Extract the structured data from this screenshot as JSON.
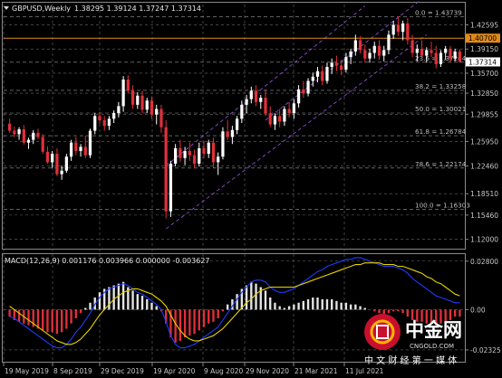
{
  "header": {
    "title": "GBPUSD,Weekly",
    "ohlc": "1.38295 1.39124 1.37247 1.37314",
    "macd_label": "MACD(12,26,9) 0.001176 0.003966 0.000000 -0.003627"
  },
  "watermark": {
    "brand": "中金网",
    "domain": "CNGOLD.COM",
    "tagline": "中 文 财 经 第 一 媒 体"
  },
  "chart_data": {
    "type": "candlestick",
    "symbol": "GBPUSD",
    "timeframe": "Weekly",
    "ohlc": [
      1.38295,
      1.39124,
      1.37247,
      1.37314
    ],
    "price_ticks": [
      "1.42595",
      "1.39150",
      "1.35700",
      "1.32850",
      "1.29855",
      "1.25950",
      "1.22460",
      "1.18510",
      "1.15460",
      "1.12000"
    ],
    "price_range": [
      1.108,
      1.455
    ],
    "x_ticks": [
      "19 May 2019",
      "8 Sep 2019",
      "29 Dec 2019",
      "19 Apr 2020",
      "9 Aug 2020",
      "29 Nov 2020",
      "21 Mar 2021",
      "11 Jul 2021"
    ],
    "horizontal_line": {
      "price": 1.407,
      "label": "1.40700",
      "color": "#e08a1a"
    },
    "current_price": {
      "price": 1.37314,
      "label": "1.37314"
    },
    "fibonacci": [
      {
        "label": "0.0 = 1.43739",
        "price": 1.43739
      },
      {
        "label": "23.6 = 1.37264",
        "price": 1.37264
      },
      {
        "label": "38.2 = 1.33258",
        "price": 1.33258
      },
      {
        "label": "50.0 = 1.30021",
        "price": 1.30021
      },
      {
        "label": "61.8 = 1.26784",
        "price": 1.26784
      },
      {
        "label": "78.6 = 1.22174",
        "price": 1.22174
      },
      {
        "label": "100.0 = 1.16303",
        "price": 1.16303
      }
    ],
    "channel_color": "#8a4cd0",
    "colors": {
      "bull": "#ffffff",
      "bear": "#e0303a",
      "grid": "#6a6a6a",
      "macd_line": "#1e3cff",
      "signal_line": "#e6d200"
    },
    "candles": [
      [
        1.285,
        1.292,
        1.272,
        1.275
      ],
      [
        1.275,
        1.281,
        1.266,
        1.27
      ],
      [
        1.27,
        1.28,
        1.262,
        1.277
      ],
      [
        1.277,
        1.283,
        1.255,
        1.258
      ],
      [
        1.258,
        1.265,
        1.249,
        1.262
      ],
      [
        1.262,
        1.276,
        1.256,
        1.272
      ],
      [
        1.272,
        1.278,
        1.263,
        1.266
      ],
      [
        1.266,
        1.27,
        1.242,
        1.245
      ],
      [
        1.245,
        1.253,
        1.228,
        1.23
      ],
      [
        1.23,
        1.246,
        1.222,
        1.242
      ],
      [
        1.242,
        1.25,
        1.21,
        1.213
      ],
      [
        1.213,
        1.225,
        1.205,
        1.218
      ],
      [
        1.218,
        1.242,
        1.215,
        1.238
      ],
      [
        1.238,
        1.262,
        1.232,
        1.258
      ],
      [
        1.258,
        1.266,
        1.24,
        1.246
      ],
      [
        1.246,
        1.256,
        1.238,
        1.252
      ],
      [
        1.252,
        1.268,
        1.236,
        1.24
      ],
      [
        1.24,
        1.278,
        1.236,
        1.275
      ],
      [
        1.275,
        1.3,
        1.27,
        1.296
      ],
      [
        1.296,
        1.302,
        1.285,
        1.29
      ],
      [
        1.29,
        1.296,
        1.275,
        1.282
      ],
      [
        1.282,
        1.296,
        1.276,
        1.292
      ],
      [
        1.292,
        1.304,
        1.286,
        1.3
      ],
      [
        1.3,
        1.316,
        1.294,
        1.31
      ],
      [
        1.31,
        1.353,
        1.302,
        1.348
      ],
      [
        1.348,
        1.354,
        1.328,
        1.332
      ],
      [
        1.332,
        1.34,
        1.306,
        1.312
      ],
      [
        1.312,
        1.33,
        1.306,
        1.325
      ],
      [
        1.325,
        1.332,
        1.3,
        1.305
      ],
      [
        1.305,
        1.322,
        1.3,
        1.318
      ],
      [
        1.318,
        1.324,
        1.292,
        1.298
      ],
      [
        1.298,
        1.312,
        1.284,
        1.306
      ],
      [
        1.306,
        1.312,
        1.272,
        1.28
      ],
      [
        1.28,
        1.29,
        1.15,
        1.16
      ],
      [
        1.16,
        1.232,
        1.152,
        1.228
      ],
      [
        1.228,
        1.256,
        1.224,
        1.25
      ],
      [
        1.25,
        1.262,
        1.23,
        1.236
      ],
      [
        1.236,
        1.252,
        1.226,
        1.246
      ],
      [
        1.246,
        1.258,
        1.232,
        1.24
      ],
      [
        1.24,
        1.248,
        1.222,
        1.228
      ],
      [
        1.228,
        1.258,
        1.224,
        1.25
      ],
      [
        1.25,
        1.26,
        1.236,
        1.242
      ],
      [
        1.242,
        1.262,
        1.236,
        1.258
      ],
      [
        1.258,
        1.265,
        1.222,
        1.23
      ],
      [
        1.23,
        1.244,
        1.212,
        1.238
      ],
      [
        1.238,
        1.28,
        1.234,
        1.274
      ],
      [
        1.274,
        1.29,
        1.262,
        1.266
      ],
      [
        1.266,
        1.282,
        1.256,
        1.276
      ],
      [
        1.276,
        1.296,
        1.27,
        1.292
      ],
      [
        1.292,
        1.318,
        1.286,
        1.312
      ],
      [
        1.312,
        1.326,
        1.3,
        1.32
      ],
      [
        1.32,
        1.338,
        1.314,
        1.332
      ],
      [
        1.332,
        1.34,
        1.31,
        1.316
      ],
      [
        1.316,
        1.326,
        1.306,
        1.322
      ],
      [
        1.322,
        1.334,
        1.296,
        1.3
      ],
      [
        1.3,
        1.31,
        1.28,
        1.284
      ],
      [
        1.284,
        1.3,
        1.276,
        1.296
      ],
      [
        1.296,
        1.306,
        1.28,
        1.288
      ],
      [
        1.288,
        1.31,
        1.282,
        1.306
      ],
      [
        1.306,
        1.316,
        1.294,
        1.3
      ],
      [
        1.3,
        1.32,
        1.292,
        1.314
      ],
      [
        1.314,
        1.34,
        1.308,
        1.334
      ],
      [
        1.334,
        1.346,
        1.322,
        1.328
      ],
      [
        1.328,
        1.35,
        1.324,
        1.346
      ],
      [
        1.346,
        1.358,
        1.338,
        1.352
      ],
      [
        1.352,
        1.366,
        1.344,
        1.36
      ],
      [
        1.36,
        1.368,
        1.34,
        1.346
      ],
      [
        1.346,
        1.372,
        1.342,
        1.366
      ],
      [
        1.366,
        1.378,
        1.356,
        1.372
      ],
      [
        1.372,
        1.382,
        1.36,
        1.368
      ],
      [
        1.368,
        1.376,
        1.354,
        1.362
      ],
      [
        1.362,
        1.386,
        1.358,
        1.38
      ],
      [
        1.38,
        1.392,
        1.37,
        1.388
      ],
      [
        1.388,
        1.412,
        1.382,
        1.404
      ],
      [
        1.404,
        1.41,
        1.385,
        1.39
      ],
      [
        1.39,
        1.398,
        1.372,
        1.378
      ],
      [
        1.378,
        1.392,
        1.372,
        1.386
      ],
      [
        1.386,
        1.402,
        1.378,
        1.396
      ],
      [
        1.396,
        1.404,
        1.376,
        1.382
      ],
      [
        1.382,
        1.396,
        1.374,
        1.39
      ],
      [
        1.39,
        1.418,
        1.384,
        1.412
      ],
      [
        1.412,
        1.432,
        1.406,
        1.426
      ],
      [
        1.426,
        1.438,
        1.41,
        1.416
      ],
      [
        1.416,
        1.432,
        1.404,
        1.428
      ],
      [
        1.428,
        1.436,
        1.398,
        1.404
      ],
      [
        1.404,
        1.412,
        1.38,
        1.386
      ],
      [
        1.386,
        1.398,
        1.374,
        1.392
      ],
      [
        1.392,
        1.404,
        1.378,
        1.382
      ],
      [
        1.382,
        1.394,
        1.372,
        1.39
      ],
      [
        1.39,
        1.402,
        1.38,
        1.386
      ],
      [
        1.386,
        1.396,
        1.364,
        1.37
      ],
      [
        1.37,
        1.39,
        1.366,
        1.386
      ],
      [
        1.386,
        1.396,
        1.376,
        1.392
      ],
      [
        1.392,
        1.396,
        1.372,
        1.378
      ],
      [
        1.378,
        1.392,
        1.374,
        1.388
      ],
      [
        1.388,
        1.3912,
        1.3725,
        1.3731
      ]
    ],
    "macd": {
      "name": "MACD(12,26,9)",
      "values": [
        0.001176,
        0.003966,
        0.0,
        -0.003627
      ],
      "ticks": [
        "0.02800",
        "0.00",
        "-0.02325"
      ],
      "range": [
        -0.029,
        0.031
      ],
      "histogram": [
        -0.004,
        -0.006,
        -0.007,
        -0.008,
        -0.009,
        -0.01,
        -0.011,
        -0.012,
        -0.013,
        -0.013,
        -0.014,
        -0.013,
        -0.011,
        -0.008,
        -0.005,
        -0.002,
        0.001,
        0.004,
        0.007,
        0.01,
        0.012,
        0.013,
        0.014,
        0.015,
        0.016,
        0.013,
        0.011,
        0.009,
        0.008,
        0.006,
        0.004,
        0.002,
        -0.001,
        -0.008,
        -0.016,
        -0.019,
        -0.018,
        -0.016,
        -0.015,
        -0.014,
        -0.012,
        -0.01,
        -0.008,
        -0.007,
        -0.005,
        -0.001,
        0.003,
        0.006,
        0.009,
        0.012,
        0.014,
        0.016,
        0.015,
        0.013,
        0.011,
        0.007,
        0.004,
        0.002,
        0.001,
        0.002,
        0.003,
        0.004,
        0.005,
        0.006,
        0.007,
        0.007,
        0.006,
        0.006,
        0.006,
        0.005,
        0.004,
        0.004,
        0.003,
        0.003,
        0.002,
        0.001,
        0.0,
        -0.001,
        -0.002,
        -0.003,
        -0.002,
        -0.001,
        -0.001,
        -0.002,
        -0.004,
        -0.006,
        -0.007,
        -0.007,
        -0.008,
        -0.008,
        -0.009,
        -0.008,
        -0.007,
        -0.006,
        -0.004,
        -0.004
      ],
      "macd_line": [
        -0.004,
        -0.005,
        -0.007,
        -0.009,
        -0.011,
        -0.013,
        -0.015,
        -0.017,
        -0.019,
        -0.021,
        -0.022,
        -0.022,
        -0.02,
        -0.017,
        -0.013,
        -0.01,
        -0.006,
        -0.002,
        0.003,
        0.007,
        0.01,
        0.012,
        0.013,
        0.014,
        0.015,
        0.014,
        0.012,
        0.01,
        0.009,
        0.007,
        0.005,
        0.003,
        0.0,
        -0.007,
        -0.015,
        -0.02,
        -0.022,
        -0.022,
        -0.021,
        -0.02,
        -0.018,
        -0.016,
        -0.014,
        -0.012,
        -0.01,
        -0.006,
        -0.002,
        0.002,
        0.006,
        0.01,
        0.013,
        0.016,
        0.017,
        0.017,
        0.016,
        0.013,
        0.011,
        0.01,
        0.01,
        0.011,
        0.012,
        0.014,
        0.016,
        0.018,
        0.02,
        0.022,
        0.023,
        0.025,
        0.026,
        0.027,
        0.028,
        0.029,
        0.029,
        0.03,
        0.03,
        0.029,
        0.028,
        0.027,
        0.026,
        0.025,
        0.025,
        0.025,
        0.024,
        0.023,
        0.021,
        0.018,
        0.016,
        0.014,
        0.012,
        0.01,
        0.008,
        0.007,
        0.006,
        0.005,
        0.004,
        0.004
      ],
      "signal_line": [
        0.002,
        0.0,
        -0.002,
        -0.004,
        -0.006,
        -0.008,
        -0.01,
        -0.012,
        -0.014,
        -0.016,
        -0.018,
        -0.019,
        -0.02,
        -0.02,
        -0.019,
        -0.017,
        -0.014,
        -0.011,
        -0.007,
        -0.003,
        0.0,
        0.003,
        0.006,
        0.008,
        0.01,
        0.011,
        0.012,
        0.012,
        0.011,
        0.01,
        0.009,
        0.007,
        0.005,
        0.002,
        -0.003,
        -0.008,
        -0.012,
        -0.015,
        -0.017,
        -0.018,
        -0.018,
        -0.017,
        -0.016,
        -0.015,
        -0.013,
        -0.011,
        -0.008,
        -0.005,
        -0.002,
        0.001,
        0.004,
        0.006,
        0.009,
        0.011,
        0.012,
        0.013,
        0.013,
        0.013,
        0.013,
        0.013,
        0.013,
        0.014,
        0.015,
        0.016,
        0.017,
        0.018,
        0.019,
        0.02,
        0.021,
        0.022,
        0.023,
        0.024,
        0.025,
        0.026,
        0.026,
        0.027,
        0.027,
        0.027,
        0.027,
        0.026,
        0.026,
        0.026,
        0.025,
        0.025,
        0.024,
        0.023,
        0.022,
        0.021,
        0.019,
        0.018,
        0.016,
        0.015,
        0.013,
        0.011,
        0.009,
        0.008
      ]
    }
  }
}
